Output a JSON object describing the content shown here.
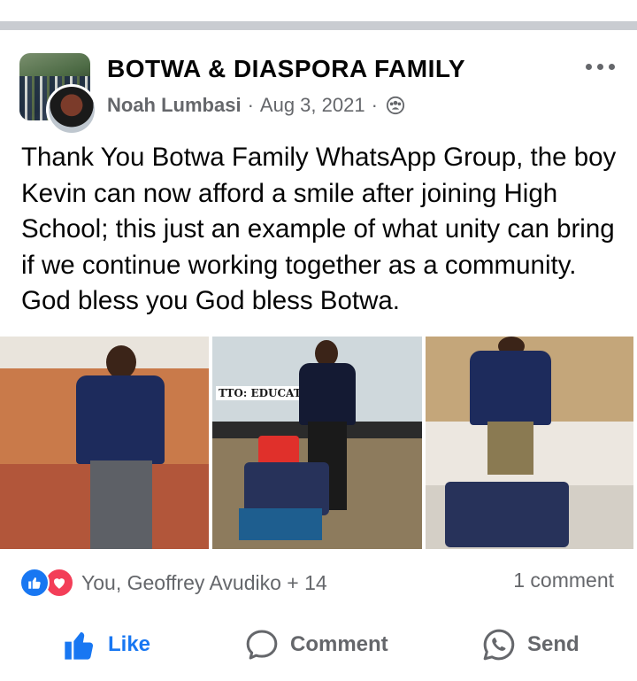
{
  "post": {
    "group_name": "BOTWA & DIASPORA FAMILY",
    "author": "Noah Lumbasi",
    "separator": "·",
    "date": "Aug 3, 2021",
    "privacy_icon": "group-members-icon",
    "text": "Thank You Botwa Family WhatsApp Group, the boy Kevin can now afford a smile after joining High School; this just an example of what unity can bring if we continue working together as a community. God bless you God bless Botwa.",
    "photos": [
      {
        "name": "photo-boy-in-uniform"
      },
      {
        "name": "photo-boy-with-basin-and-bedding",
        "sign_text": "TTO: EDUCATION IS"
      },
      {
        "name": "photo-boy-with-bag-and-bedding"
      }
    ]
  },
  "reactions": {
    "icons": [
      "like-reaction-icon",
      "love-reaction-icon"
    ],
    "summary": "You, Geoffrey Avudiko + 14",
    "comments": "1 comment"
  },
  "actions": {
    "like": "Like",
    "comment": "Comment",
    "send": "Send"
  },
  "colors": {
    "accent": "#1877f2",
    "love": "#f33e58",
    "secondary_text": "#65676b",
    "primary_text": "#050505"
  }
}
